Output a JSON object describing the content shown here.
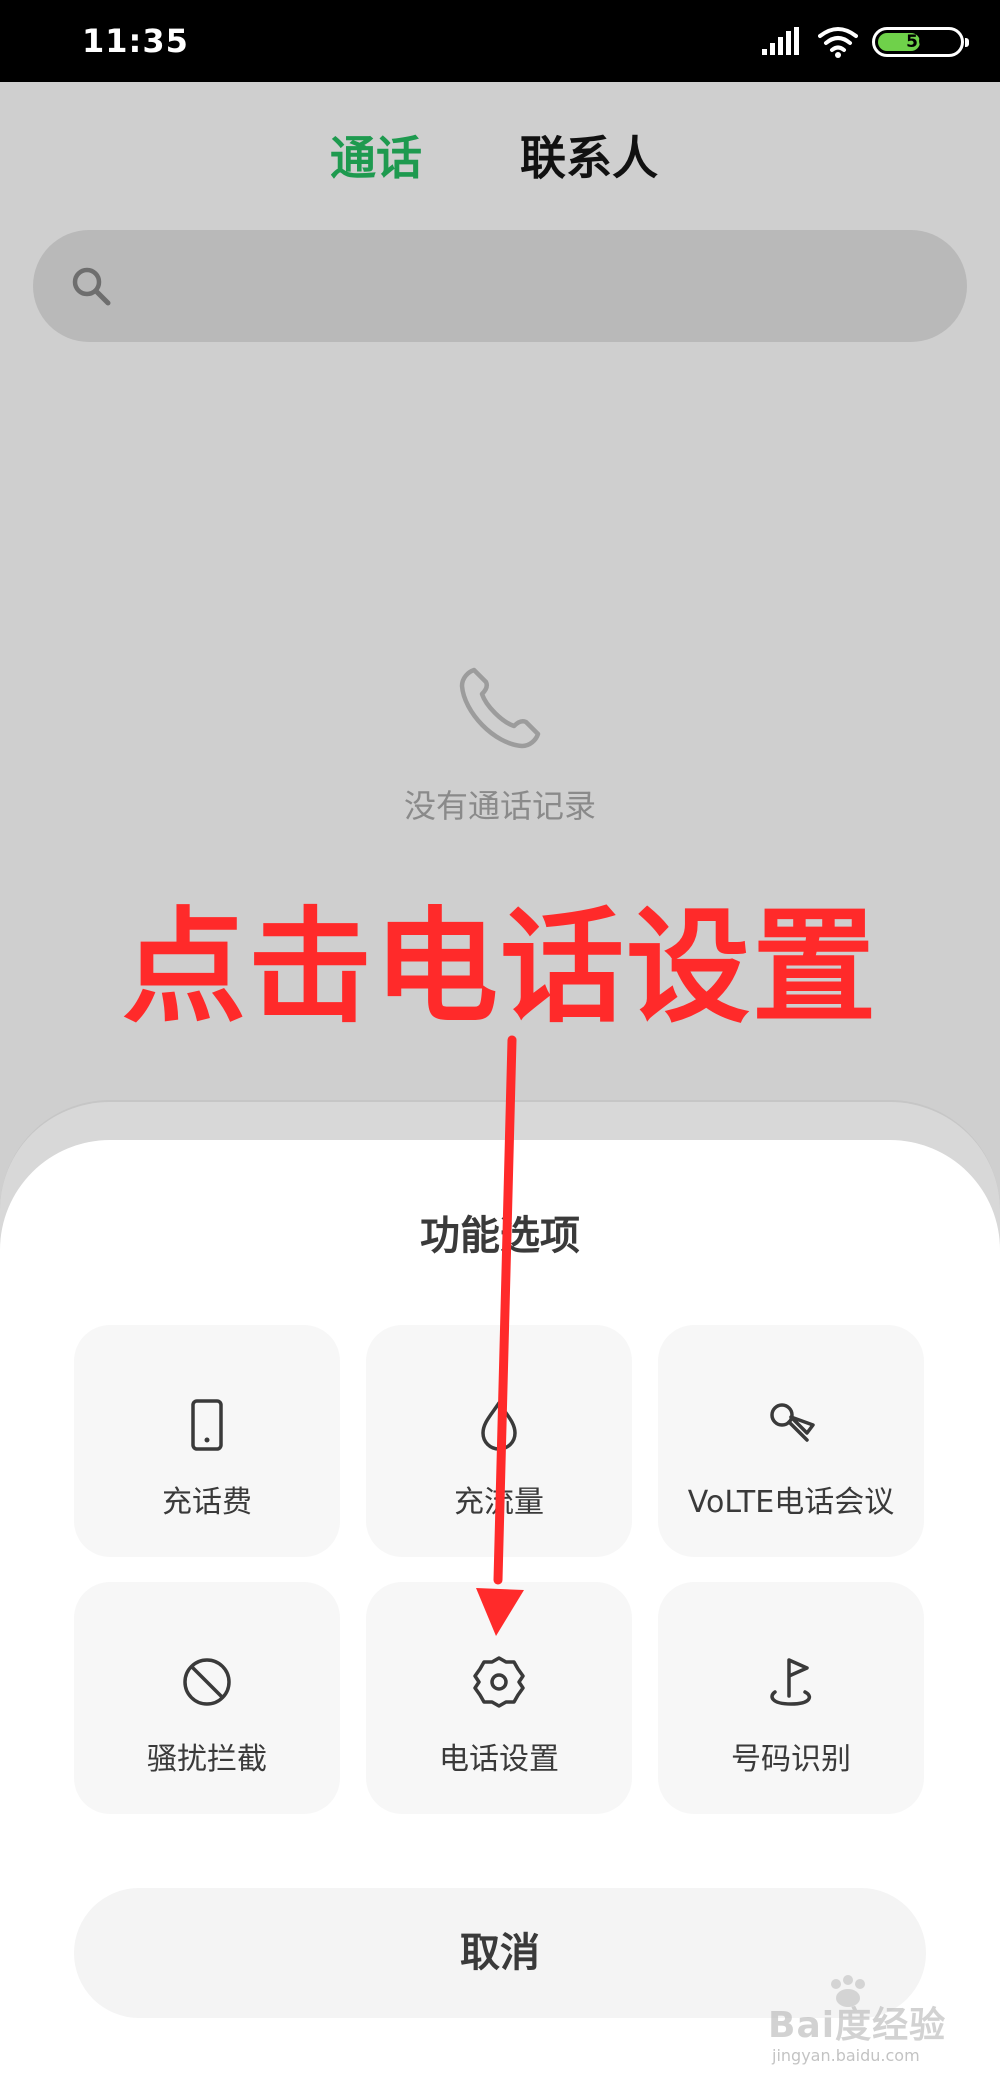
{
  "status_bar": {
    "time": "11:35",
    "battery_level": "56",
    "battery_fraction": 0.56,
    "battery_color": "#6fd14a"
  },
  "tabs": [
    {
      "label": "通话",
      "active": true,
      "color": "#1e9a4f"
    },
    {
      "label": "联系人",
      "active": false,
      "color": "#111111"
    }
  ],
  "search": {
    "icon": "search-icon",
    "placeholder": ""
  },
  "empty_state": {
    "icon": "phone-icon",
    "text": "没有通话记录",
    "text_color": "#8a8a8a"
  },
  "annotation": {
    "text": "点击电话设置",
    "color": "#ff2a2a"
  },
  "sheet": {
    "title": "功能选项",
    "text_color": "#3a3a3a",
    "tile_color": "#f7f7f7",
    "options": [
      {
        "label": "充话费",
        "icon": "mobile-phone-icon"
      },
      {
        "label": "充流量",
        "icon": "data-drop-icon"
      },
      {
        "label": "VoLTE电话会议",
        "icon": "conference-call-icon"
      },
      {
        "label": "骚扰拦截",
        "icon": "block-icon"
      },
      {
        "label": "电话设置",
        "icon": "gear-icon"
      },
      {
        "label": "号码识别",
        "icon": "flag-location-icon"
      }
    ],
    "cancel_label": "取消",
    "cancel_color": "#f4f4f4"
  },
  "watermark": {
    "brand": "Bai度经验",
    "url": "jingyan.baidu.com"
  }
}
